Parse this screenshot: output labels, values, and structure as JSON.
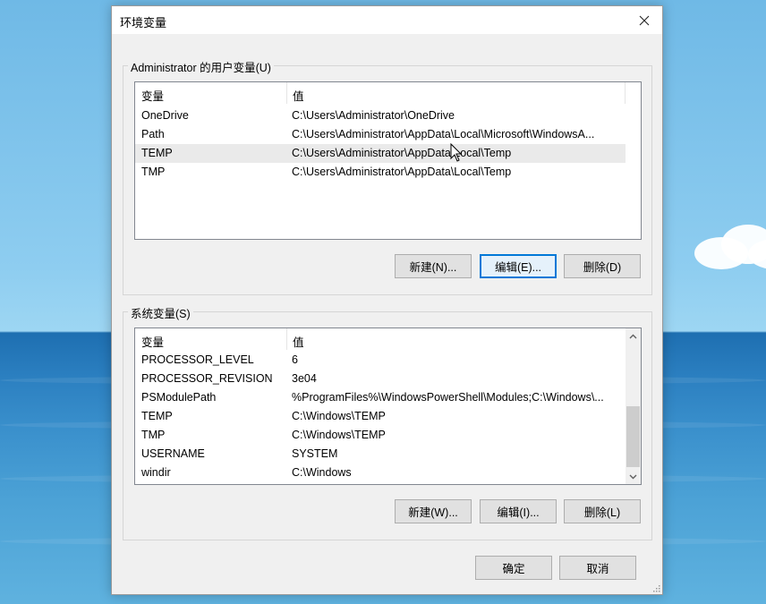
{
  "dialog": {
    "title": "环境变量",
    "close_icon": "close-icon"
  },
  "user_vars": {
    "group_label": "Administrator 的用户变量(U)",
    "columns": [
      "变量",
      "值"
    ],
    "rows": [
      {
        "name": "OneDrive",
        "value": "C:\\Users\\Administrator\\OneDrive"
      },
      {
        "name": "Path",
        "value": "C:\\Users\\Administrator\\AppData\\Local\\Microsoft\\WindowsA..."
      },
      {
        "name": "TEMP",
        "value": "C:\\Users\\Administrator\\AppData\\Local\\Temp"
      },
      {
        "name": "TMP",
        "value": "C:\\Users\\Administrator\\AppData\\Local\\Temp"
      }
    ],
    "new_button": "新建(N)...",
    "edit_button": "编辑(E)...",
    "delete_button": "删除(D)"
  },
  "system_vars": {
    "group_label": "系统变量(S)",
    "columns": [
      "变量",
      "值"
    ],
    "rows": [
      {
        "name": "PROCESSOR_LEVEL",
        "value": "6"
      },
      {
        "name": "PROCESSOR_REVISION",
        "value": "3e04"
      },
      {
        "name": "PSModulePath",
        "value": "%ProgramFiles%\\WindowsPowerShell\\Modules;C:\\Windows\\..."
      },
      {
        "name": "TEMP",
        "value": "C:\\Windows\\TEMP"
      },
      {
        "name": "TMP",
        "value": "C:\\Windows\\TEMP"
      },
      {
        "name": "USERNAME",
        "value": "SYSTEM"
      },
      {
        "name": "windir",
        "value": "C:\\Windows"
      }
    ],
    "new_button": "新建(W)...",
    "edit_button": "编辑(I)...",
    "delete_button": "删除(L)"
  },
  "footer": {
    "ok_button": "确定",
    "cancel_button": "取消"
  },
  "colors": {
    "accent": "#0078d7",
    "selected_row": "#eaeaea",
    "dialog_bg": "#f0f0f0"
  }
}
